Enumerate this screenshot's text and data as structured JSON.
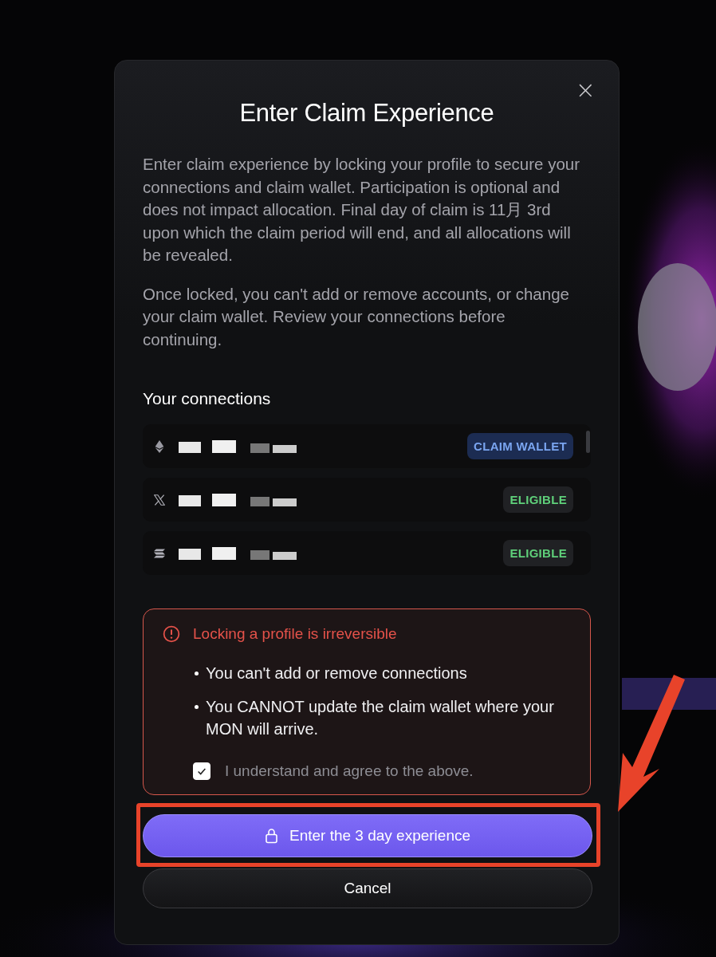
{
  "dialog": {
    "title": "Enter Claim Experience",
    "close": "×",
    "paragraphs": [
      "Enter claim experience by locking your profile to secure your connections and claim wallet. Participation is optional and does not impact allocation. Final day of claim is 11月 3rd upon which the claim period will end, and all allocations will be revealed.",
      "Once locked, you can't add or remove accounts, or change your claim wallet. Review your connections before continuing."
    ],
    "connections_heading": "Your connections",
    "connections": [
      {
        "kind": "ethereum",
        "tag": {
          "label": "CLAIM WALLET",
          "kind": "wallet",
          "color": "#1c2c52"
        }
      },
      {
        "kind": "x",
        "tag": {
          "label": "ELIGIBLE",
          "kind": "eligible",
          "color": "#202124"
        }
      },
      {
        "kind": "solana",
        "tag": {
          "label": "ELIGIBLE",
          "kind": "eligible",
          "color": "#202124"
        }
      }
    ],
    "warning": {
      "title": "Locking a profile is irreversible",
      "bullets": [
        "You can't add or remove connections",
        "You CANNOT update the claim wallet where your MON will arrive."
      ],
      "agree": {
        "label": "I understand and agree to the above.",
        "checked": true
      }
    },
    "primary_button": "Enter the 3 day experience",
    "cancel_button": "Cancel"
  }
}
